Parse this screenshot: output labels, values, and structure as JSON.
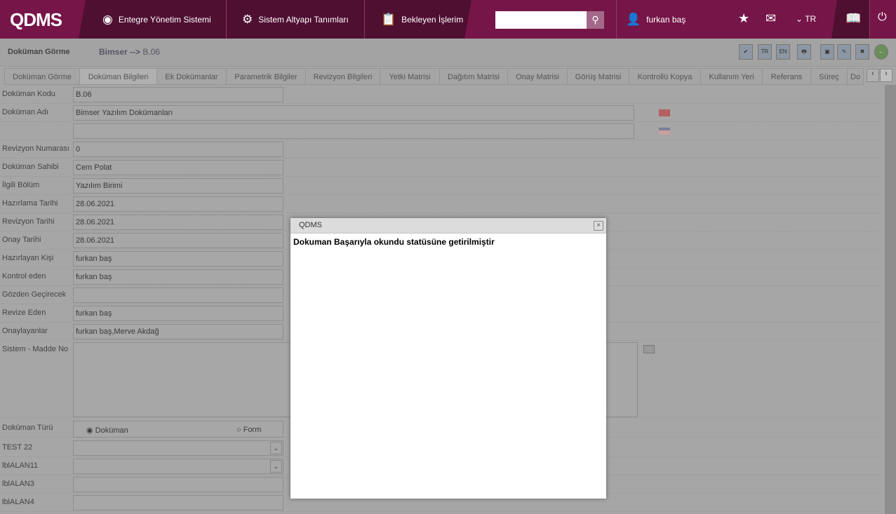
{
  "header": {
    "logo": "QDMS",
    "nav": [
      "Entegre Yönetim Sistemi",
      "Sistem Altyapı Tanımları",
      "Bekleyen İşlerim"
    ],
    "search_placeholder": "",
    "user": "furkan baş",
    "lang": "TR"
  },
  "page": {
    "title": "Doküman Görme",
    "breadcrumb_root": "Bimser",
    "breadcrumb_arrow": "-->",
    "breadcrumb_code": "B.06"
  },
  "toolbar": {
    "tr": "TR",
    "en": "EN"
  },
  "tabs": [
    "Doküman Görme",
    "Doküman Bilgileri",
    "Ek Dokümanlar",
    "Parametrik Bilgiler",
    "Revizyon Bilgileri",
    "Yetki Matrisi",
    "Dağıtım Matrisi",
    "Onay Matrisi",
    "Görüş Matrisi",
    "Kontrollü Kopya",
    "Kullanım Yeri",
    "Referans",
    "Süreç",
    "Do"
  ],
  "fields": [
    {
      "label": "Doküman Kodu",
      "value": "B.06"
    },
    {
      "label": "Doküman Adı",
      "value": "Bimser Yazılım Dokümanları"
    },
    {
      "label": "",
      "value": ""
    },
    {
      "label": "Revizyon Numarası",
      "value": "0"
    },
    {
      "label": "Doküman Sahibi",
      "value": "Cem Polat"
    },
    {
      "label": "İlgili Bölüm",
      "value": "Yazılım Birimi"
    },
    {
      "label": "Hazırlama Tarihi",
      "value": "28.06.2021"
    },
    {
      "label": "Revizyon Tarihi",
      "value": "28.06.2021"
    },
    {
      "label": "Onay Tarihi",
      "value": "28.06.2021"
    },
    {
      "label": "Hazırlayan Kişi",
      "value": "furkan baş"
    },
    {
      "label": "Kontrol eden",
      "value": "furkan baş"
    },
    {
      "label": "Gözden Geçirecek",
      "value": ""
    },
    {
      "label": "Revize Eden",
      "value": "furkan baş"
    },
    {
      "label": "Onaylayanlar",
      "value": "furkan baş,Merve Akdağ"
    }
  ],
  "sistem_madde": {
    "label": "Sistem - Madde No",
    "value": ""
  },
  "dokuman_turu": {
    "label": "Doküman Türü",
    "options": [
      "Doküman",
      "Form"
    ],
    "selected": "Doküman"
  },
  "extra": [
    {
      "label": "TEST 22",
      "type": "select"
    },
    {
      "label": "lblALAN11",
      "type": "select"
    },
    {
      "label": "lblALAN3",
      "type": "text"
    },
    {
      "label": "lblALAN4",
      "type": "text"
    }
  ],
  "dialog": {
    "title": "QDMS",
    "message": "Dokuman Başarıyla okundu statüsüne getirilmiştir",
    "close": "×"
  }
}
